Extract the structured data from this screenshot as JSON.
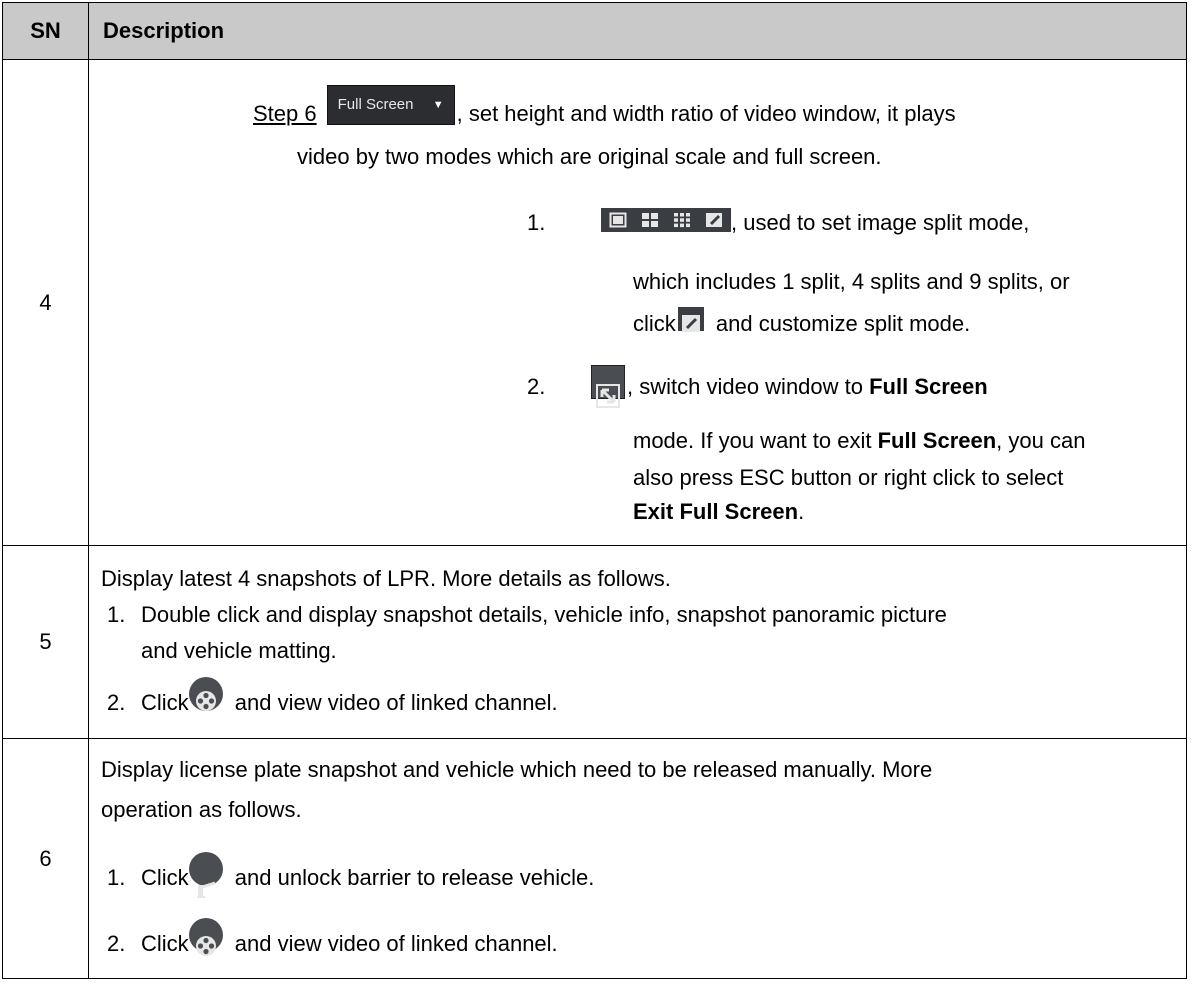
{
  "header": {
    "sn": "SN",
    "description": "Description"
  },
  "row4": {
    "sn": "4",
    "step_label": "Step 6",
    "dropdown_value": "Full Screen",
    "step_text_1": ", set height and width ratio of video window, it plays",
    "step_text_2": "video by two modes which are original scale and full screen.",
    "item1_num": "1.",
    "item1_text_1": ", used to set image split mode,",
    "item1_text_2": "which includes 1 split, 4 splits and 9 splits, or",
    "item1_text_3a": "click",
    "item1_text_3b": " and customize split mode.",
    "item2_num": "2.",
    "item2_text_1": ", switch video window to ",
    "item2_bold_1": "Full Screen",
    "item2_text_2": "mode. If you want to exit ",
    "item2_bold_2": "Full Screen",
    "item2_text_3": ", you can",
    "item2_text_4": "also press ESC button or right click to select",
    "item2_bold_3": "Exit Full Screen",
    "item2_text_5": "."
  },
  "row5": {
    "sn": "5",
    "intro": "Display latest 4 snapshots of LPR. More details as follows.",
    "item1_num": "1.",
    "item1_text_1": "Double click and display snapshot details, vehicle info, snapshot panoramic picture",
    "item1_text_2": "and vehicle matting.",
    "item2_num": "2.",
    "item2_text_a": "Click",
    "item2_text_b": " and view video of linked channel."
  },
  "row6": {
    "sn": "6",
    "intro_1": "Display license plate snapshot and vehicle which need to be released manually. More",
    "intro_2": "operation as follows.",
    "item1_num": "1.",
    "item1_text_a": "Click",
    "item1_text_b": " and unlock barrier to release vehicle.",
    "item2_num": "2.",
    "item2_text_a": "Click",
    "item2_text_b": " and view video of linked channel."
  },
  "icons": {
    "dropdown_bg": "#2b2d31",
    "split_bar_bg": "#3a3d42",
    "round_icon_bg": "#4a4d52",
    "header_bg": "#c9c9c9"
  }
}
